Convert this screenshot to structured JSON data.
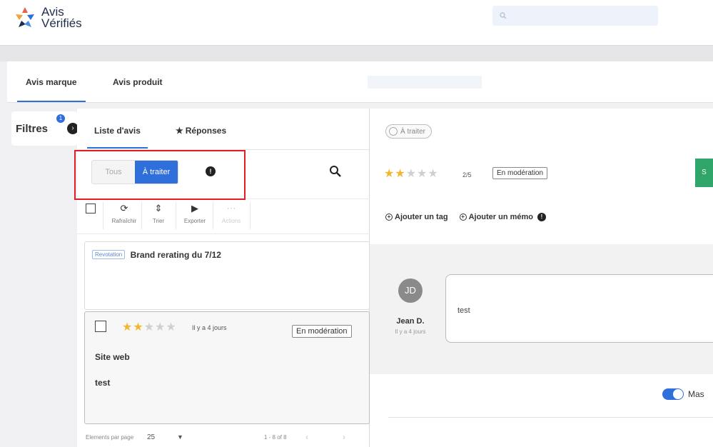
{
  "brand": {
    "line1": "Avis",
    "line2": "Vérifiés",
    "logo_icon": "avis-verifies-logo-icon"
  },
  "colors": {
    "accent": "#2f6fdb",
    "star": "#f1b82d",
    "highlight": "#e11d2a",
    "green": "#2fa56a"
  },
  "main_tabs": [
    {
      "label": "Avis marque",
      "active": true
    },
    {
      "label": "Avis produit",
      "active": false
    }
  ],
  "filters": {
    "label": "Filtres",
    "badge": "1"
  },
  "sub_tabs": [
    {
      "label": "Liste d'avis",
      "active": true
    },
    {
      "label": "Réponses",
      "icon": "star-icon",
      "active": false
    }
  ],
  "status_filter": {
    "options": [
      "Tous",
      "À traiter"
    ],
    "selected": "À traiter"
  },
  "toolbar": {
    "refresh": "Rafraîchir",
    "sort": "Trier",
    "export": "Exporter",
    "actions": "Actions"
  },
  "review_list": [
    {
      "tag": "Revotation",
      "title": "Brand rerating du 7/12"
    },
    {
      "rating": 2,
      "max_rating": 5,
      "time": "Il y a 4 jours",
      "status": "En modération",
      "type": "Site web",
      "text": "test"
    }
  ],
  "pager": {
    "label": "Elements par page",
    "per_page": "25",
    "range": "1 - 8 of 8"
  },
  "detail": {
    "toggle_label": "À traiter",
    "rating": 2,
    "rating_text": "2/5",
    "status": "En modération",
    "add_tag": "Ajouter un tag",
    "add_memo": "Ajouter un mémo",
    "comment": {
      "initials": "JD",
      "author": "Jean D.",
      "time": "Il y a 4 jours",
      "text": "test"
    },
    "mask_label": "Mas"
  }
}
